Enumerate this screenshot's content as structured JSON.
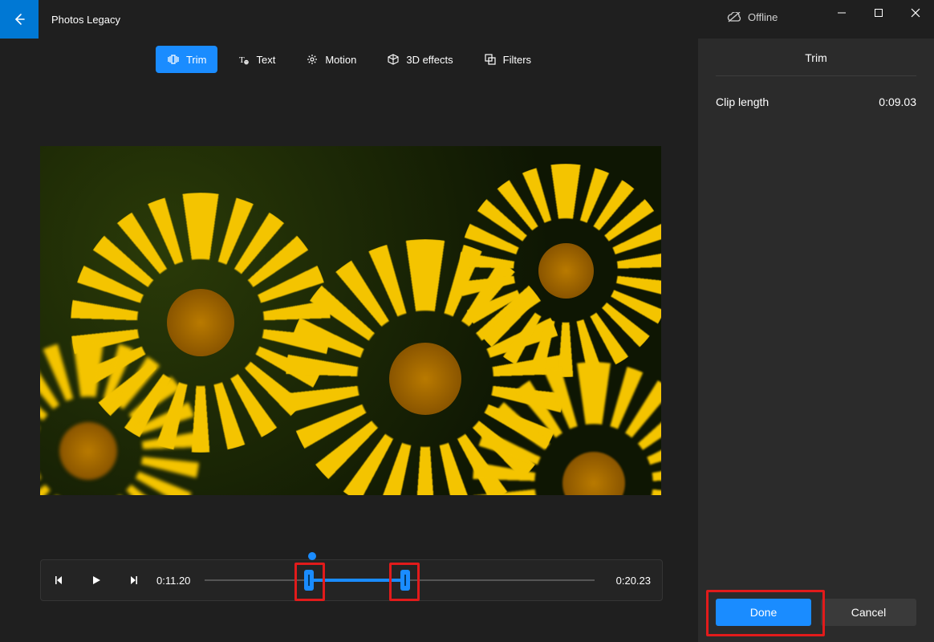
{
  "app": {
    "title": "Photos Legacy"
  },
  "status": {
    "offline": "Offline"
  },
  "toolbar": {
    "trim": "Trim",
    "text": "Text",
    "motion": "Motion",
    "effects": "3D effects",
    "filters": "Filters"
  },
  "playback": {
    "current_time": "0:11.20",
    "total_time": "0:20.23"
  },
  "panel": {
    "title": "Trim",
    "clip_length_label": "Clip length",
    "clip_length_value": "0:09.03",
    "done": "Done",
    "cancel": "Cancel"
  }
}
